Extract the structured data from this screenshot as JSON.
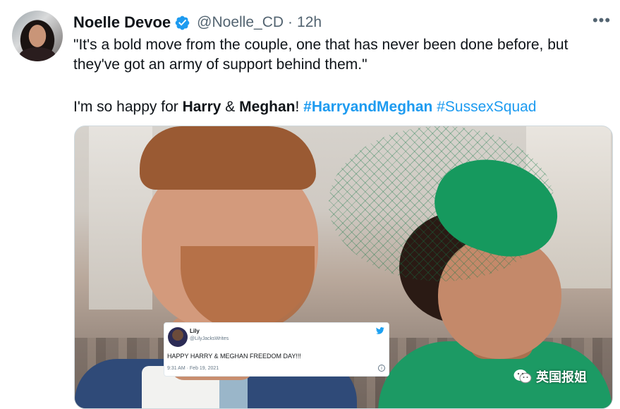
{
  "tweet": {
    "author": {
      "name": "Noelle Devoe",
      "handle": "@Noelle_CD",
      "verified": true,
      "avatar_icon": "avatar-photo"
    },
    "separator": "·",
    "time": "12h",
    "more_icon": "more-dots-icon",
    "more_label": "•••",
    "quote": "\"It's a bold move from the couple, one that has never been done before, but they've got an army of support behind them.\"",
    "line2": {
      "t1": "I'm so happy for ",
      "harry": "Harry",
      "amp": " & ",
      "meghan": "Meghan",
      "excl": "! ",
      "hashtag1": "#HarryandMeghan",
      "space": " ",
      "hashtag2": "#SussexSquad"
    },
    "link_color": "#1d9bf0"
  },
  "media": {
    "embedded_tweet": {
      "name": "Lily",
      "handle": "@LilyJacksWrites",
      "text": "HAPPY HARRY & MEGHAN FREEDOM DAY!!!",
      "date": "9:31 AM · Feb 19, 2021",
      "info_label": "i",
      "bird_color": "#1da1f2"
    },
    "watermark": {
      "text": "英国报姐",
      "icon": "wechat-icon"
    }
  }
}
